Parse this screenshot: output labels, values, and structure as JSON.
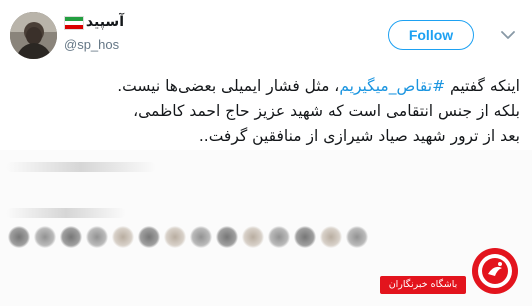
{
  "tweet": {
    "author": {
      "display_name": "آسپید",
      "handle": "@sp_hos"
    },
    "follow_label": "Follow",
    "text_lines": [
      {
        "before": "اینکه گفتیم ",
        "hashtag": "#تقاص_میگیریم",
        "after": "، مثل فشار ایمیلی بعضی‌ها نیست."
      },
      {
        "before": "بلکه از جنس انتقامی است که شهید عزیز حاج احمد کاظمی،",
        "hashtag": "",
        "after": ""
      },
      {
        "before": "بعد از ترور شهید صیاد شیرازی از منافقین گرفت..",
        "hashtag": "",
        "after": ""
      }
    ]
  },
  "watermark": {
    "label": "باشگاه خبرنگاران"
  },
  "colors": {
    "twitter_blue": "#1da1f2",
    "hashtag_blue": "#1b95e0",
    "watermark_red": "#e3141d"
  },
  "icons": {
    "avatar": "profile-photo",
    "flag": "iran-flag-icon",
    "menu": "chevron-down-icon",
    "logo": "yjc-logo-icon"
  }
}
